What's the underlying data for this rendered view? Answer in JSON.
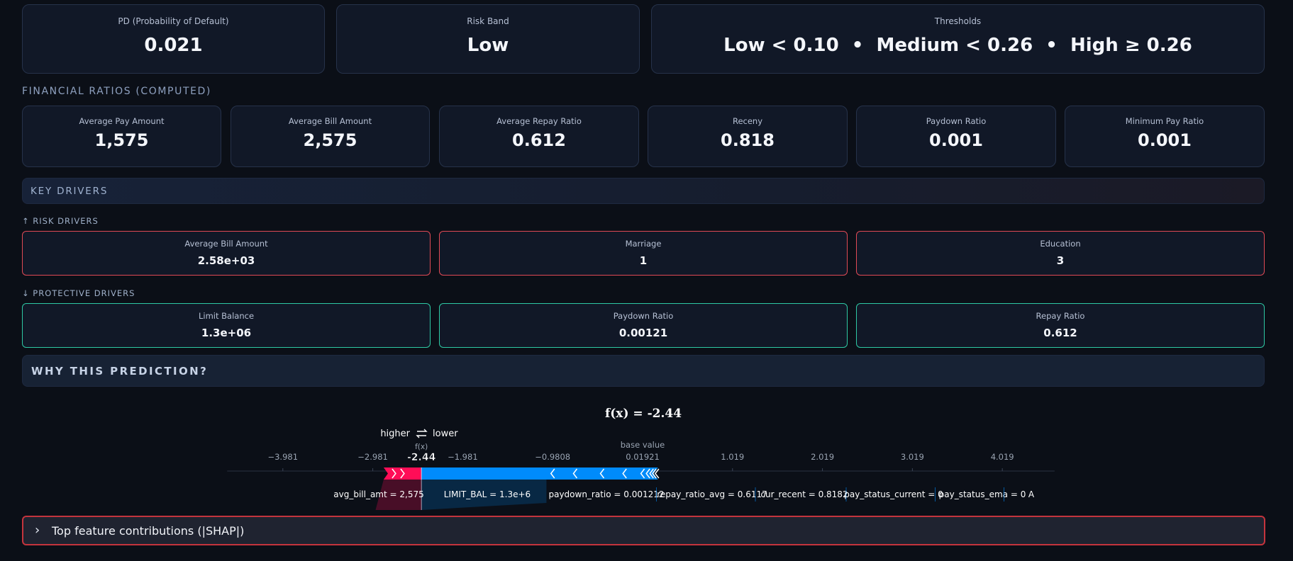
{
  "summary": {
    "pd_label": "PD (Probability of Default)",
    "pd_value": "0.021",
    "band_label": "Risk Band",
    "band_value": "Low",
    "thresholds_label": "Thresholds",
    "thresholds_value": "Low < 0.10  •  Medium < 0.26  •  High ≥ 0.26"
  },
  "ratios": {
    "section_title": "FINANCIAL RATIOS (COMPUTED)",
    "items": [
      {
        "label": "Average Pay Amount",
        "value": "1,575"
      },
      {
        "label": "Average Bill Amount",
        "value": "2,575"
      },
      {
        "label": "Average Repay Ratio",
        "value": "0.612"
      },
      {
        "label": "Receny",
        "value": "0.818"
      },
      {
        "label": "Paydown Ratio",
        "value": "0.001"
      },
      {
        "label": "Minimum Pay Ratio",
        "value": "0.001"
      }
    ]
  },
  "key_drivers": {
    "title": "KEY DRIVERS",
    "risk_title": "↑ RISK DRIVERS",
    "risk": [
      {
        "label": "Average Bill Amount",
        "value": "2.58e+03"
      },
      {
        "label": "Marriage",
        "value": "1"
      },
      {
        "label": "Education",
        "value": "3"
      }
    ],
    "protective_title": "↓ PROTECTIVE DRIVERS",
    "protective": [
      {
        "label": "Limit Balance",
        "value": "1.3e+06"
      },
      {
        "label": "Paydown Ratio",
        "value": "0.00121"
      },
      {
        "label": "Repay Ratio",
        "value": "0.612"
      }
    ]
  },
  "why": {
    "title": "WHY THIS PREDICTION?"
  },
  "colors": {
    "risk": "#ff0d57",
    "protective": "#008bfb",
    "risk_border": "#e04a55",
    "protective_border": "#2ec9a4"
  },
  "chart_data": {
    "type": "force",
    "title": "f(x) = -2.44",
    "fx": -2.44,
    "base_value": 0.01921,
    "legend_higher": "higher",
    "legend_lower": "lower",
    "legend_icon": "swap-arrows-icon",
    "fx_label": "f(x)",
    "fx_value_label": "-2.44",
    "base_label": "base value",
    "xlim": [
      -4.5,
      4.5
    ],
    "ticks": [
      {
        "value": -3.981,
        "label": "−3.981"
      },
      {
        "value": -2.981,
        "label": "−2.981"
      },
      {
        "value": -1.981,
        "label": "−1.981"
      },
      {
        "value": -0.9808,
        "label": "−0.9808"
      },
      {
        "value": 0.01921,
        "label": "0.01921"
      },
      {
        "value": 1.019,
        "label": "1.019"
      },
      {
        "value": 2.019,
        "label": "2.019"
      },
      {
        "value": 3.019,
        "label": "3.019"
      },
      {
        "value": 4.019,
        "label": "4.019"
      }
    ],
    "positive_segment": [
      -2.86,
      -2.44
    ],
    "negative_segment": [
      -2.44,
      0.19
    ],
    "feature_labels": [
      {
        "label": "avg_bill_amt = 2,575",
        "side": "positive"
      },
      {
        "label": "LIMIT_BAL = 1.3e+6",
        "side": "negative"
      },
      {
        "label": "paydown_ratio = 0.001212",
        "side": "negative"
      },
      {
        "label": "repay_ratio_avg = 0.6117",
        "side": "negative"
      },
      {
        "label": "cur_recent = 0.8182",
        "side": "negative"
      },
      {
        "label": "pay_status_current = 0",
        "side": "negative"
      },
      {
        "label": "pay_status_ema = 0",
        "side": "negative"
      },
      {
        "label": "A",
        "side": "negative"
      }
    ]
  },
  "expander": {
    "label": "Top feature contributions (|SHAP|)",
    "icon": "chevron-right-icon"
  }
}
